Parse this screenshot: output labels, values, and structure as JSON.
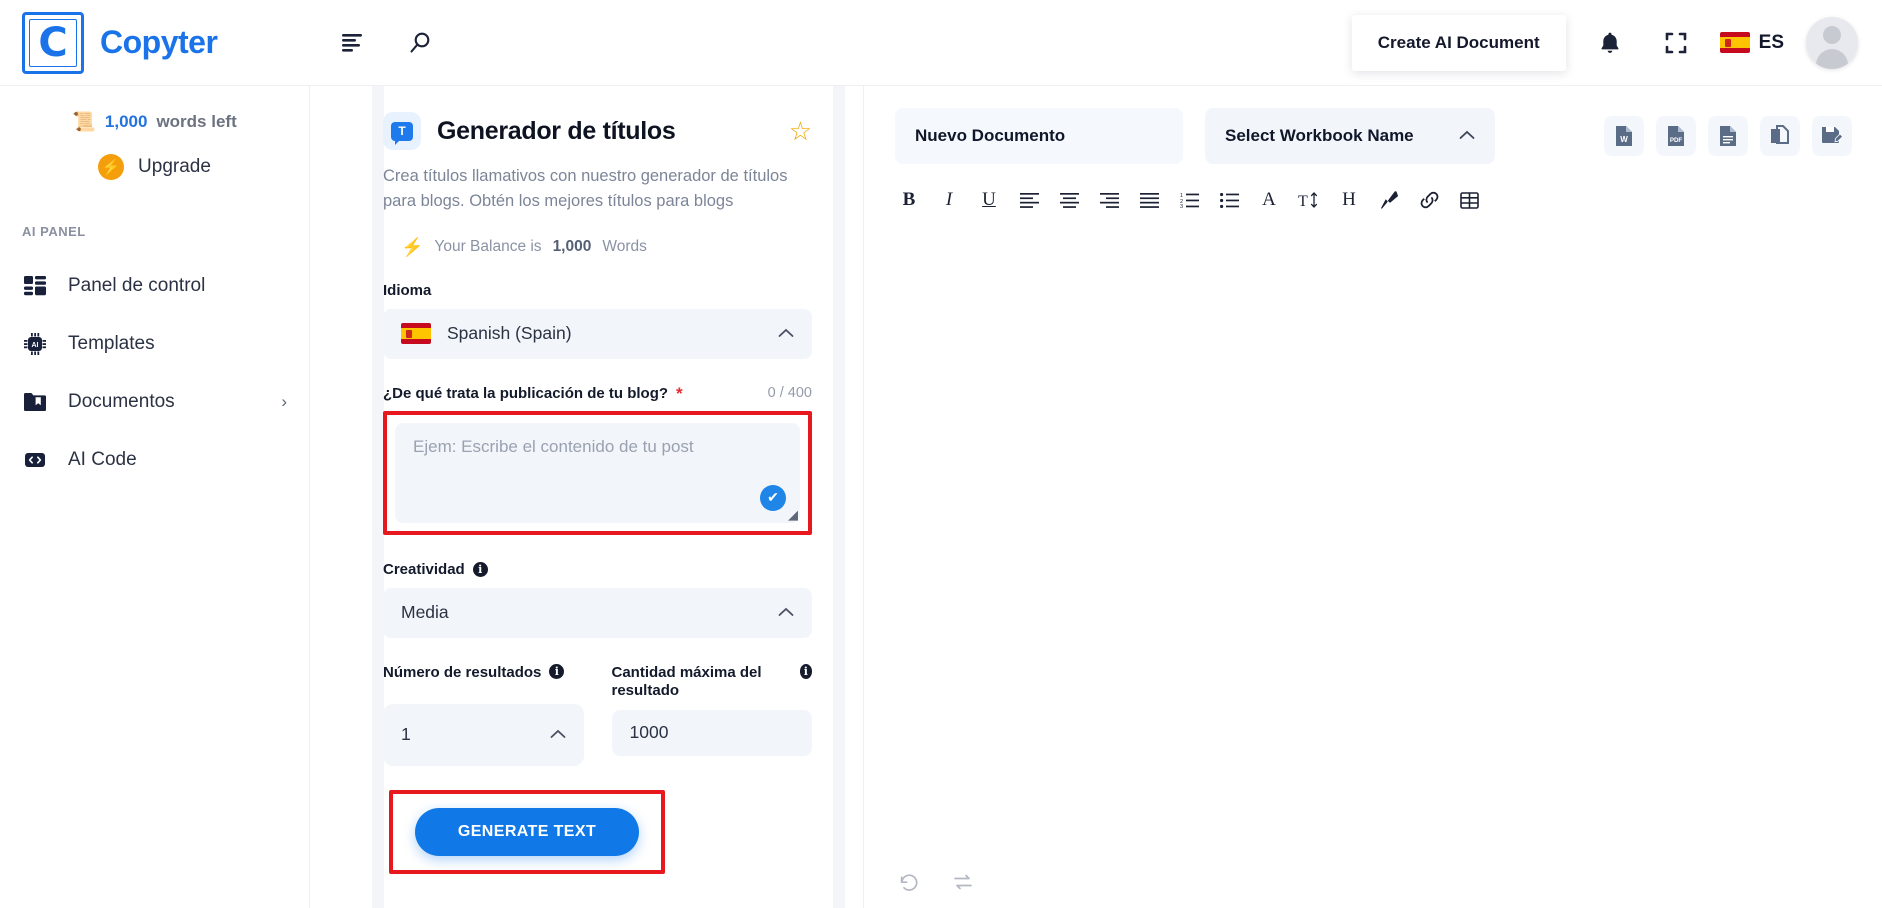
{
  "brand": {
    "mark_letter": "C",
    "name": "Copyter"
  },
  "header": {
    "menu_icon": "hamburger-icon",
    "search_icon": "search-icon",
    "create_doc_label": "Create AI Document",
    "bell_icon": "bell-icon",
    "fullscreen_icon": "fullscreen-icon",
    "language_code": "ES",
    "flag": "spain-flag-icon",
    "avatar": "user-avatar"
  },
  "sidebar": {
    "words_count": "1,000",
    "words_suffix": "words left",
    "scroll_icon": "scroll-icon",
    "upgrade_label": "Upgrade",
    "section_label": "AI PANEL",
    "items": [
      {
        "label": "Panel de control",
        "icon": "dashboard-icon",
        "has_chevron": false
      },
      {
        "label": "Templates",
        "icon": "ai-chip-icon",
        "has_chevron": false
      },
      {
        "label": "Documentos",
        "icon": "folder-bookmark-icon",
        "has_chevron": true,
        "chevron": "›"
      },
      {
        "label": "AI Code",
        "icon": "code-brackets-icon",
        "has_chevron": false
      }
    ]
  },
  "form": {
    "template_icon": "speech-bubble-t-icon",
    "template_icon_letter": "T",
    "title": "Generador de títulos",
    "star_icon": "star-icon",
    "description": "Crea títulos llamativos con nuestro generador de títulos para blogs. Obtén los mejores títulos para blogs",
    "balance_prefix": "Your Balance is",
    "balance_amount": "1,000",
    "balance_suffix": "Words",
    "language": {
      "label": "Idioma",
      "value": "Spanish (Spain)",
      "flag": "spain-flag-icon",
      "chevron": "⌃"
    },
    "prompt": {
      "label": "¿De qué trata la publicación de tu blog?",
      "required_mark": "*",
      "counter": "0 / 400",
      "placeholder": "Ejem: Escribe el contenido de tu post",
      "value": "",
      "check_icon": "check-circle-icon",
      "resize_grip": "resize-grip-icon"
    },
    "creativity": {
      "label": "Creatividad",
      "info": "i",
      "value": "Media",
      "chevron": "⌃"
    },
    "num_results": {
      "label": "Número de resultados",
      "info": "i",
      "value": "1",
      "chevron": "⌃"
    },
    "max_amount": {
      "label": "Cantidad máxima del resultado",
      "info": "i",
      "value": "1000"
    },
    "generate_label": "GENERATE TEXT",
    "highlight_color": "#e8191e",
    "accent_color": "#1178e8"
  },
  "editor": {
    "doc_name": "Nuevo Documento",
    "workbook_value": "Select Workbook Name",
    "workbook_chevron": "⌃",
    "exports": [
      {
        "name": "export-word-icon",
        "label": "W"
      },
      {
        "name": "export-pdf-icon",
        "label": "PDF"
      },
      {
        "name": "export-text-icon",
        "label": ""
      },
      {
        "name": "copy-document-icon",
        "label": ""
      },
      {
        "name": "save-document-icon",
        "label": ""
      }
    ],
    "toolbar": [
      {
        "name": "bold-icon",
        "glyph": "B"
      },
      {
        "name": "italic-icon",
        "glyph": "I"
      },
      {
        "name": "underline-icon",
        "glyph": "U"
      },
      {
        "name": "align-left-icon",
        "glyph": ""
      },
      {
        "name": "align-center-icon",
        "glyph": ""
      },
      {
        "name": "align-right-icon",
        "glyph": ""
      },
      {
        "name": "align-justify-icon",
        "glyph": ""
      },
      {
        "name": "ordered-list-icon",
        "glyph": ""
      },
      {
        "name": "unordered-list-icon",
        "glyph": ""
      },
      {
        "name": "font-family-icon",
        "glyph": "A"
      },
      {
        "name": "font-size-icon",
        "glyph": "T"
      },
      {
        "name": "heading-icon",
        "glyph": "H"
      },
      {
        "name": "brush-icon",
        "glyph": ""
      },
      {
        "name": "link-icon",
        "glyph": ""
      },
      {
        "name": "table-icon",
        "glyph": ""
      }
    ],
    "content": "",
    "footer": [
      {
        "name": "undo-icon"
      },
      {
        "name": "redo-icon"
      }
    ]
  }
}
